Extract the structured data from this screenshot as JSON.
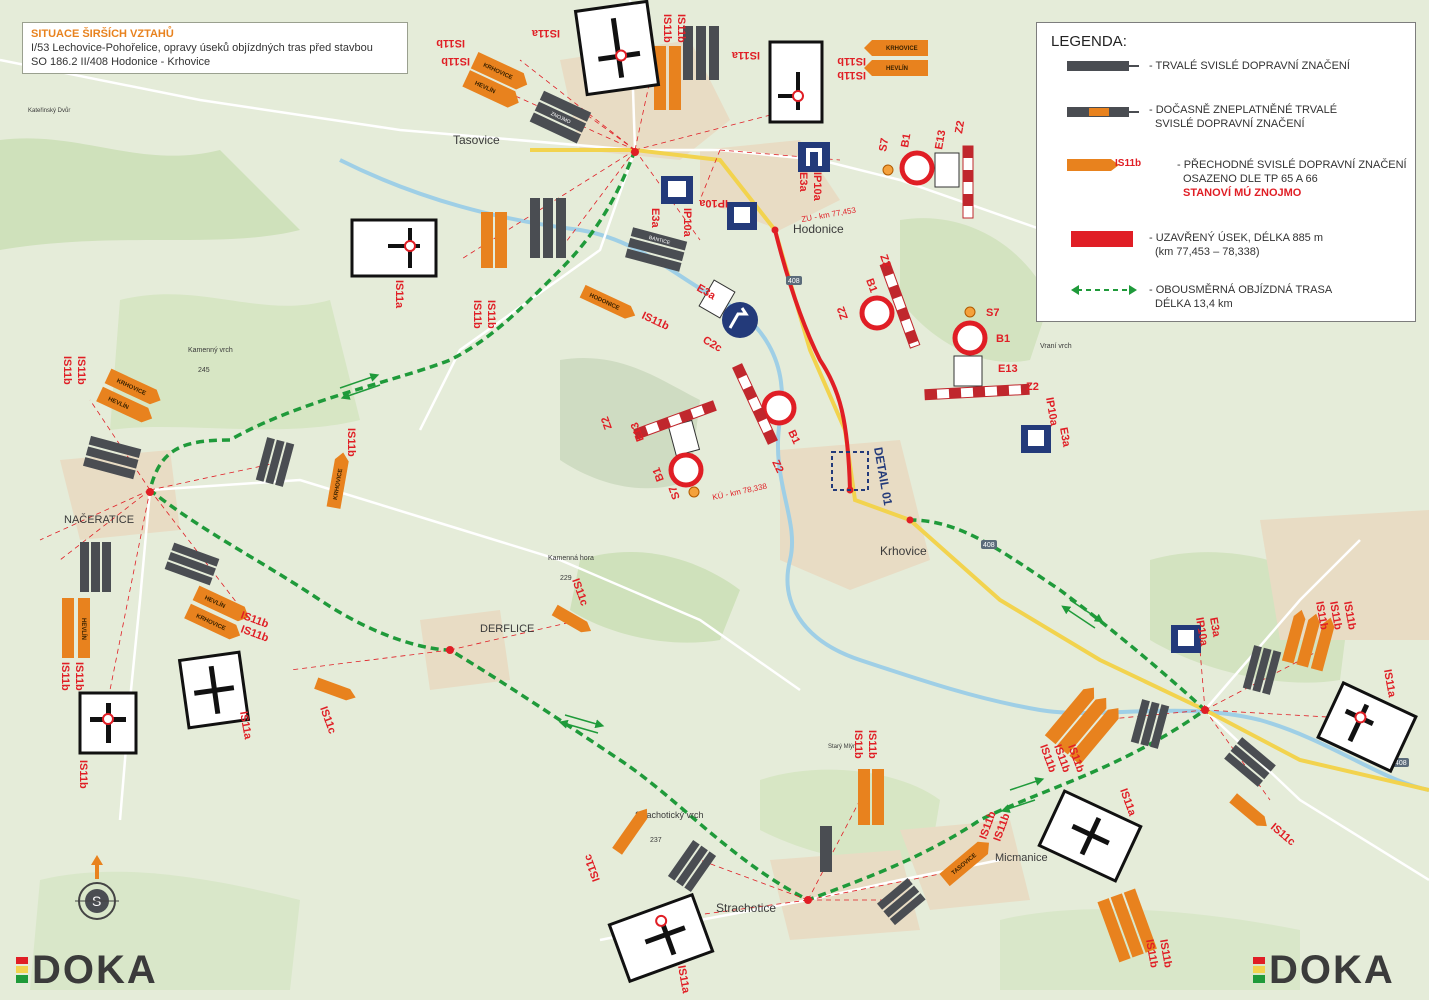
{
  "title": {
    "heading": "SITUACE ŠIRŠÍCH VZTAHŮ",
    "line2": "I/53 Lechovice-Pohořelice, opravy úseků objízdných tras před stavbou",
    "line3": "SO 186.2 II/408 Hodonice - Krhovice"
  },
  "legend": {
    "heading": "LEGENDA:",
    "items": [
      {
        "text": "- TRVALÉ SVISLÉ DOPRAVNÍ ZNAČENÍ"
      },
      {
        "text": "- DOČASNĚ ZNEPLATNĚNÉ TRVALÉ",
        "text2": "SVISLÉ DOPRAVNÍ ZNAČENÍ"
      },
      {
        "text": "- PŘECHODNÉ SVISLÉ DOPRAVNÍ ZNAČENÍ",
        "text2": "OSAZENO DLE TP 65 A 66",
        "text3": "STANOVÍ MÚ ZNOJMO",
        "sign_label": "IS11b"
      },
      {
        "text": "- UZAVŘENÝ ÚSEK, DÉLKA 885 m",
        "text2": "(km 77,453 – 78,338)"
      },
      {
        "text": "- OBOUSMĚRNÁ OBJÍZDNÁ TRASA",
        "text2": "DÉLKA 13,4 km"
      }
    ]
  },
  "places": {
    "tasovice": "Tasovice",
    "hodonice": "Hodonice",
    "krhovice": "Krhovice",
    "naceratice": "NAČERATICE",
    "derflice": "DERFLICE",
    "micmanice": "Micmanice",
    "strachotice": "Strachotice",
    "kamenny_vrch": "Kamenný vrch",
    "kamenny_vrch_alt": "245",
    "kamenna_hora": "Kamenná hora",
    "kamenna_hora_alt": "229",
    "strachoticky": "Strachotický vrch",
    "strachoticky_alt": "237",
    "vrani": "Vraní vrch",
    "katerinsky": "Kateřinský Dvůr",
    "stary_mlyn": "Starý Mlýn"
  },
  "chainage": {
    "zu": "ZU - km 77,453",
    "ku": "KÚ - km 78,338"
  },
  "detail": "DETAIL 01",
  "road_408": "408",
  "sign_codes": {
    "IS11a": "IS11a",
    "IS11b": "IS11b",
    "IS11c": "IS11c",
    "E3a": "E3a",
    "IP10a": "IP10a",
    "B1": "B1",
    "S7": "S7",
    "E13": "E13",
    "Z2": "Z2",
    "C2c": "C2c"
  },
  "sign_texts": {
    "hevlin": "HEVLÍN",
    "krhovice": "KRHOVICE",
    "tasovice": "TASOVICE",
    "hodonice": "HODONICE",
    "znojmo": "ZNOJMO",
    "bantice": "BANTICE"
  },
  "compass_letter": "S",
  "logo": "DOKA",
  "colors": {
    "orange": "#e8821e",
    "closure": "#e01e25",
    "detour": "#1f9a3a",
    "dark_sign": "#4a4d52",
    "blue_sign": "#233a7a"
  }
}
